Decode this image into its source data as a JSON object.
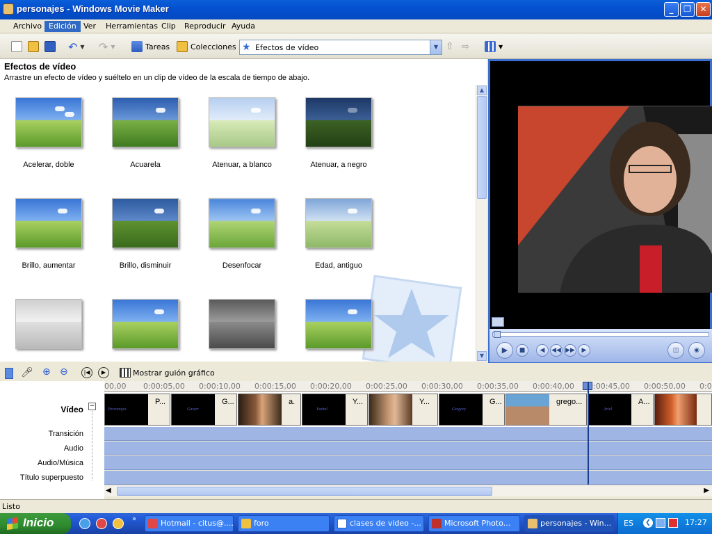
{
  "window": {
    "title": "personajes - Windows Movie Maker"
  },
  "menu": [
    "Archivo",
    "Edición",
    "Ver",
    "Herramientas",
    "Clip",
    "Reproducir",
    "Ayuda"
  ],
  "toolbar": {
    "tasks": "Tareas",
    "collections": "Colecciones",
    "combo_value": "Efectos de vídeo"
  },
  "effects": {
    "title": "Efectos de vídeo",
    "subtitle": "Arrastre un efecto de vídeo y suéltelo en un clip de vídeo de la escala de tiempo de abajo.",
    "items": [
      {
        "label": "Acelerar, doble"
      },
      {
        "label": "Acuarela"
      },
      {
        "label": "Atenuar, a blanco"
      },
      {
        "label": "Atenuar, a negro"
      },
      {
        "label": "Brillo, aumentar"
      },
      {
        "label": "Brillo, disminuir"
      },
      {
        "label": "Desenfocar"
      },
      {
        "label": "Edad, antiguo"
      },
      {
        "label": ""
      },
      {
        "label": ""
      },
      {
        "label": ""
      },
      {
        "label": ""
      }
    ]
  },
  "timeline": {
    "storyboard_label": "Mostrar guión gráfico",
    "ruler": [
      "00,00",
      "0:00:05,00",
      "0:00:10,00",
      "0:00:15,00",
      "0:00:20,00",
      "0:00:25,00",
      "0:00:30,00",
      "0:00:35,00",
      "0:00:40,00",
      "0:00:45,00",
      "0:00:50,00",
      "0:0"
    ],
    "tracks": {
      "video": "Vídeo",
      "transition": "Transición",
      "audio": "Audio",
      "music": "Audio/Música",
      "title": "Título superpuesto"
    },
    "clips": [
      {
        "caption": "P...",
        "title_card": "Personajes"
      },
      {
        "caption": "G...",
        "title_card": "Gavier"
      },
      {
        "caption": "a.",
        "title_card": ""
      },
      {
        "caption": "Y...",
        "title_card": "Ysabel"
      },
      {
        "caption": "Y...",
        "title_card": ""
      },
      {
        "caption": "G...",
        "title_card": "Gregory"
      },
      {
        "caption": "grego...",
        "title_card": ""
      },
      {
        "caption": "A...",
        "title_card": "Ariel"
      },
      {
        "caption": "",
        "title_card": ""
      }
    ]
  },
  "status": {
    "text": "Listo"
  },
  "taskbar": {
    "start": "Inicio",
    "tasks": [
      "Hotmail - citus@....",
      "foro",
      "clases de video -...",
      "Microsoft Photo...",
      "personajes - Win..."
    ],
    "lang": "ES",
    "clock": "17:27"
  }
}
